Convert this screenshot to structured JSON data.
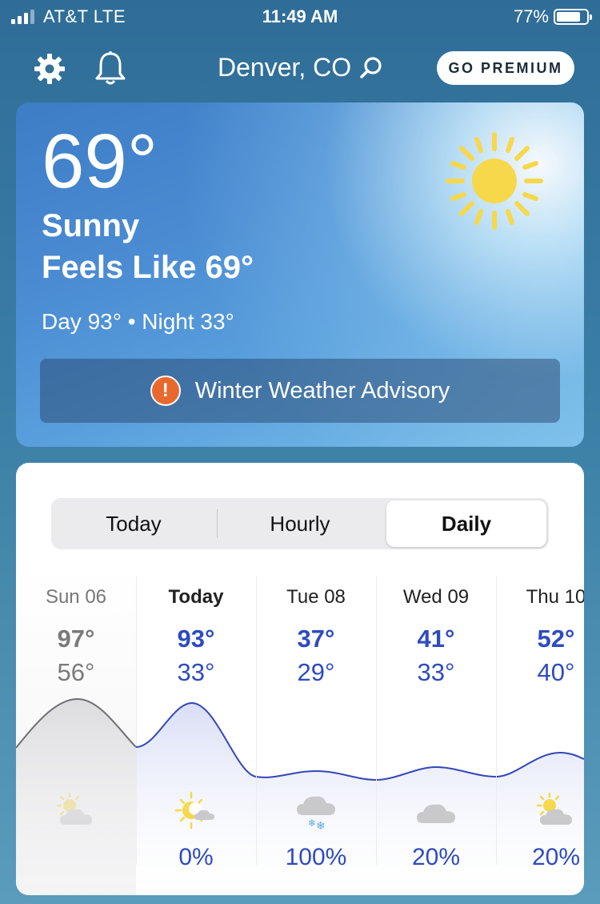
{
  "status_bar": {
    "carrier": "AT&T   LTE",
    "time": "11:49 AM",
    "battery": "77%"
  },
  "header": {
    "location": "Denver, CO",
    "premium_label": "GO PREMIUM",
    "icons": [
      "gear-icon",
      "bell-icon",
      "search-icon"
    ]
  },
  "current": {
    "temperature": "69°",
    "phrase": "Sunny",
    "feels_like": "Feels Like 69°",
    "day_night": "Day 93° • Night 33°",
    "condition_icon": "sun-icon",
    "advisory": "Winter Weather Advisory"
  },
  "tabs": {
    "today": "Today",
    "hourly": "Hourly",
    "daily": "Daily",
    "selected": "Daily"
  },
  "daily": [
    {
      "day": "Sun 06",
      "high": "97°",
      "low": "56°",
      "icon": "partly-cloudy-icon",
      "precip": "",
      "past": true
    },
    {
      "day": "Today",
      "high": "93°",
      "low": "33°",
      "icon": "sun-moon-cloud-icon",
      "precip": "0%",
      "past": false
    },
    {
      "day": "Tue 08",
      "high": "37°",
      "low": "29°",
      "icon": "snow-cloud-icon",
      "precip": "100%",
      "past": false
    },
    {
      "day": "Wed 09",
      "high": "41°",
      "low": "33°",
      "icon": "cloud-icon",
      "precip": "20%",
      "past": false
    },
    {
      "day": "Thu 10",
      "high": "52°",
      "low": "40°",
      "icon": "partly-cloudy-icon",
      "precip": "20%",
      "past": false
    }
  ],
  "colors": {
    "accent_blue": "#2e4bc0",
    "advisory_orange": "#e8692e",
    "sun_yellow": "#f7d84a"
  }
}
